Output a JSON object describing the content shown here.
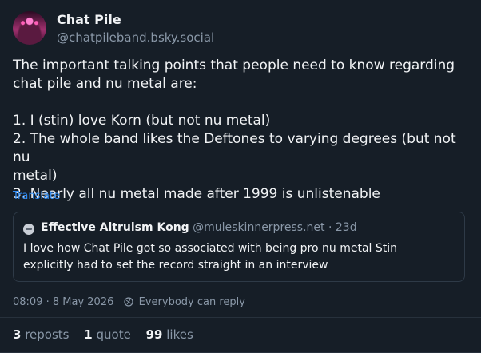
{
  "post": {
    "author_name": "Chat Pile",
    "author_handle": "@chatpileband.bsky.social",
    "text_lines": [
      "The important talking points that people need to know regarding",
      "chat pile and nu metal are:",
      "1. I (stin) love Korn (but not nu metal)",
      "2. The whole band likes the Deftones to varying degrees (but not nu",
      "metal)",
      "3. Nearly all nu metal made after 1999 is unlistenable"
    ],
    "translate_label": "Translate",
    "timestamp": "08:09 · 8 May 2026",
    "reply_setting": "Everybody can reply"
  },
  "quote": {
    "author_name": "Effective Altruism Kong",
    "author_handle": "@muleskinnerpress.net",
    "age": "· 23d",
    "text_lines": [
      "I love how Chat Pile got so associated with being pro nu metal Stin",
      "explicitly had to set the record straight in an interview"
    ]
  },
  "stats": {
    "reposts_count": "3",
    "reposts_label": "reposts",
    "quotes_count": "1",
    "quotes_label": "quote",
    "likes_count": "99",
    "likes_label": "likes"
  },
  "colors": {
    "background": "#161e27",
    "text": "#f1f3f5",
    "muted": "#8a98a8",
    "link": "#2f8cf5",
    "border": "#2e3a47"
  },
  "icons": {
    "reply_setting": "globe-icon",
    "quote_avatar": "avatar-icon"
  }
}
